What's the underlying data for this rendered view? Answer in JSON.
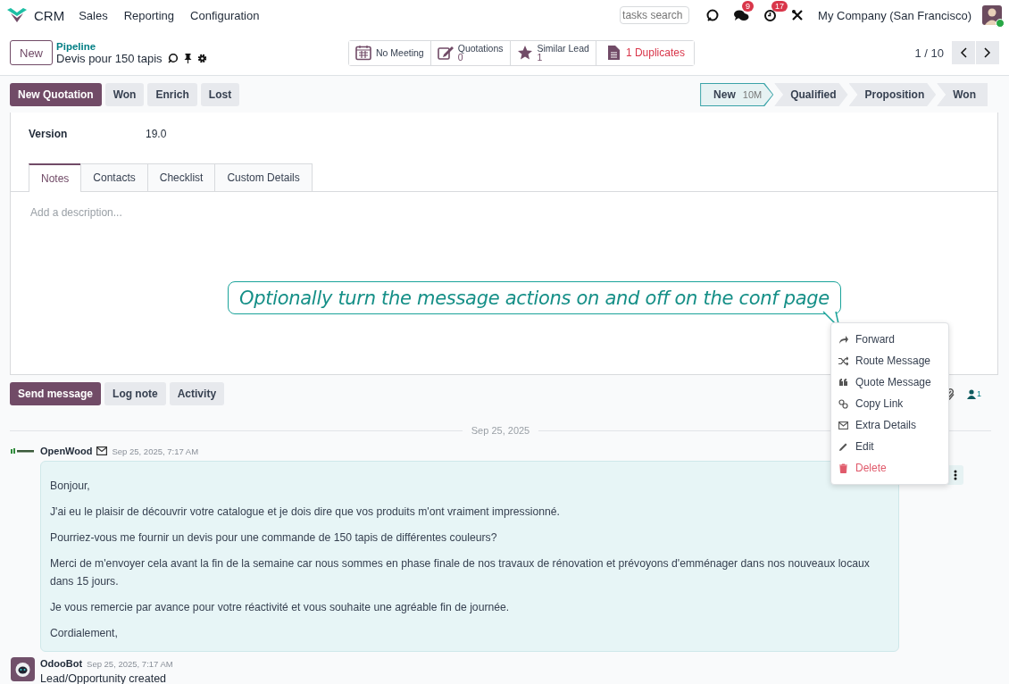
{
  "navbar": {
    "app": "CRM",
    "menus": [
      "Sales",
      "Reporting",
      "Configuration"
    ],
    "search": {
      "placeholder": "tasks search"
    },
    "messages_badge": "9",
    "activities_badge": "17",
    "company": "My Company (San Francisco)",
    "user_online": true
  },
  "control_panel": {
    "new_button": "New",
    "breadcrumb": "Pipeline",
    "record_title": "Devis pour 150 tapis",
    "stat_buttons": [
      {
        "kind": "plain",
        "label": "No Meeting"
      },
      {
        "kind": "count",
        "label": "Quotations",
        "value": "0"
      },
      {
        "kind": "count",
        "label": "Similar Lead",
        "value": "1"
      },
      {
        "kind": "alert",
        "label": "1 Duplicates"
      }
    ],
    "pager": "1 / 10"
  },
  "actions": [
    {
      "label": "New Quotation",
      "primary": true
    },
    {
      "label": "Won",
      "primary": false
    },
    {
      "label": "Enrich",
      "primary": false
    },
    {
      "label": "Lost",
      "primary": false
    }
  ],
  "stages": [
    {
      "label": "New",
      "selected": true,
      "duration": "10M"
    },
    {
      "label": "Qualified",
      "selected": false
    },
    {
      "label": "Proposition",
      "selected": false
    },
    {
      "label": "Won",
      "selected": false
    }
  ],
  "form": {
    "fields": [
      {
        "label": "Version",
        "value": "19.0"
      }
    ],
    "tabs": [
      {
        "label": "Notes",
        "selected": true
      },
      {
        "label": "Contacts",
        "selected": false
      },
      {
        "label": "Checklist",
        "selected": false
      },
      {
        "label": "Custom Details",
        "selected": false
      }
    ],
    "notes": {
      "placeholder": "Add a description..."
    }
  },
  "callout": "Optionally turn the message actions on and off on the conf page",
  "chatter": {
    "buttons": [
      {
        "label": "Send message",
        "selected": true
      },
      {
        "label": "Log note",
        "selected": false
      },
      {
        "label": "Activity",
        "selected": false
      }
    ],
    "followers": "1",
    "date_separator": "Sep 25, 2025",
    "messages": [
      {
        "kind": "email",
        "author": "OpenWood",
        "date": "Sep 25, 2025, 7:17 AM",
        "paragraphs": [
          "Bonjour,",
          "J'ai eu le plaisir de découvrir votre catalogue et je dois dire que vos produits m'ont vraiment impressionné.",
          "Pourriez-vous me fournir un devis pour une commande de 150 tapis de différentes couleurs?",
          "Merci de m'envoyer cela avant la fin de la semaine car nous sommes en phase finale de nos travaux de rénovation et prévoyons d'emménager dans nos nouveaux locaux dans 15 jours.",
          "Je vous remercie par avance pour votre réactivité et vous souhaite une agréable fin de journée.",
          "Cordialement,"
        ]
      },
      {
        "kind": "note",
        "author": "OdooBot",
        "date": "Sep 25, 2025, 7:17 AM",
        "paragraphs": [
          "Lead/Opportunity created"
        ]
      }
    ],
    "message_menu": [
      {
        "label": "Forward",
        "danger": false
      },
      {
        "label": "Route Message",
        "danger": false
      },
      {
        "label": "Quote Message",
        "danger": false
      },
      {
        "label": "Copy Link",
        "danger": false
      },
      {
        "label": "Extra Details",
        "danger": false
      },
      {
        "label": "Edit",
        "danger": false
      },
      {
        "label": "Delete",
        "danger": true
      }
    ]
  }
}
